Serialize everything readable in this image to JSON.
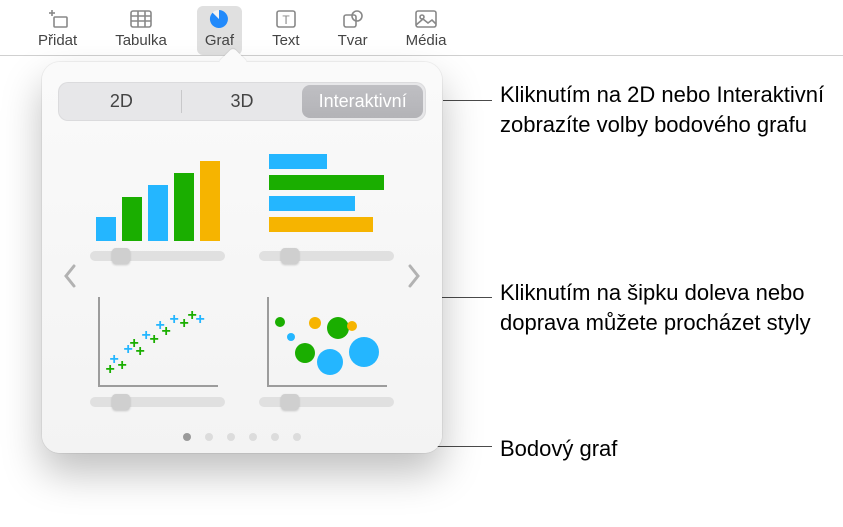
{
  "toolbar": {
    "items": [
      {
        "label": "Přidat",
        "icon": "insert-icon"
      },
      {
        "label": "Tabulka",
        "icon": "table-icon"
      },
      {
        "label": "Graf",
        "icon": "chart-icon",
        "active": true
      },
      {
        "label": "Text",
        "icon": "text-icon"
      },
      {
        "label": "Tvar",
        "icon": "shape-icon"
      },
      {
        "label": "Média",
        "icon": "media-icon"
      }
    ]
  },
  "segmented": {
    "tab_2d": "2D",
    "tab_3d": "3D",
    "tab_interactive": "Interaktivní"
  },
  "callouts": {
    "c1": "Kliknutím na 2D nebo Interaktivní zobrazíte volby bodového grafu",
    "c2": "Kliknutím na šipku doleva nebo doprava můžete procházet styly",
    "c3": "Bodový graf"
  },
  "page_dots": {
    "count": 6,
    "current": 0
  },
  "colors": {
    "green": "#1aae00",
    "blue": "#24b6ff",
    "yellow": "#f6b400"
  }
}
